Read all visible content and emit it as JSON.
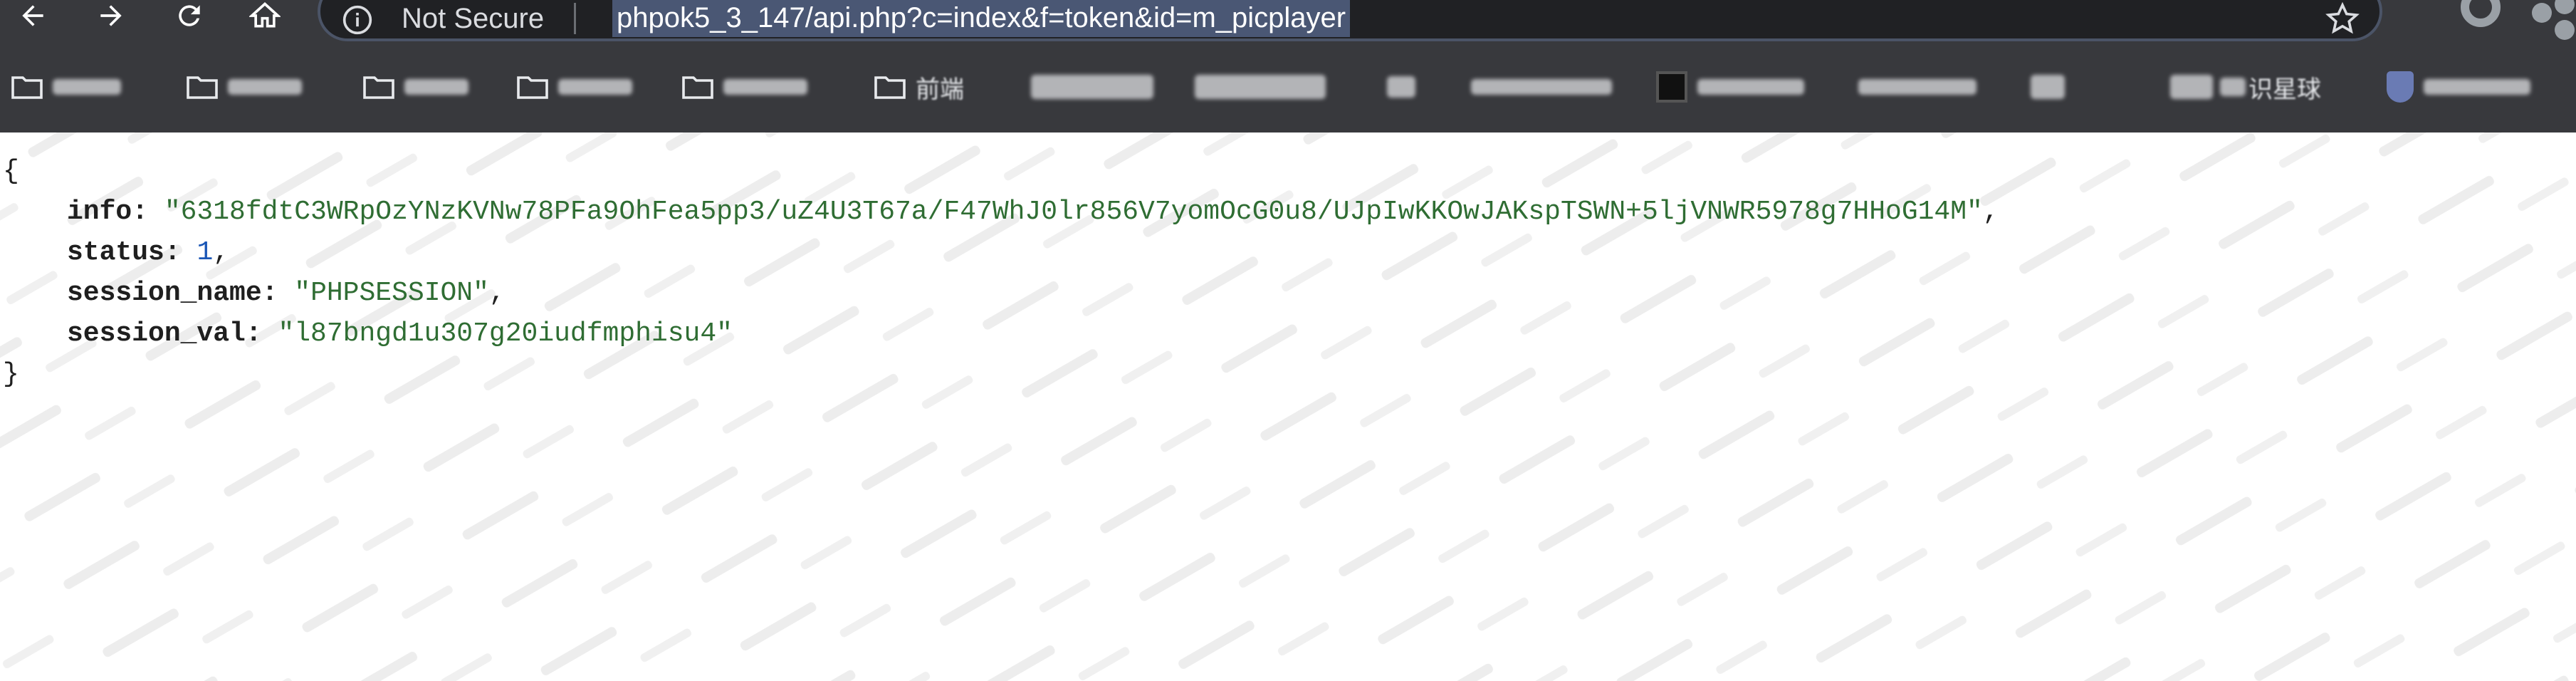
{
  "browser": {
    "security_label": "Not Secure",
    "url": "phpok5_3_147/api.php?c=index&f=token&id=m_picplayer",
    "icons": [
      "back-icon",
      "forward-icon",
      "reload-icon",
      "home-icon",
      "info-icon",
      "star-icon",
      "profile-icon",
      "extension-icon"
    ],
    "bookmarks": [
      {
        "label": ""
      },
      {
        "label": ""
      },
      {
        "label": ""
      },
      {
        "label": ""
      },
      {
        "label": ""
      },
      {
        "label": "前端"
      },
      {
        "label": ""
      },
      {
        "label": ""
      },
      {
        "label": ""
      },
      {
        "label": ""
      },
      {
        "label": ""
      },
      {
        "label": ""
      },
      {
        "label": ""
      },
      {
        "label": "识星球"
      },
      {
        "label": ""
      }
    ]
  },
  "response": {
    "open_brace": "{",
    "close_brace": "}",
    "info_key": "info",
    "info_value": "\"6318fdtC3WRpOzYNzKVNw78PFa9OhFea5pp3/uZ4U3T67a/F47WhJ0lr856V7yomOcG0u8/UJpIwKKOwJAKspTSWN+5ljVNWR5978g7HHoG14M\"",
    "status_key": "status",
    "status_value": "1",
    "session_name_key": "session_name",
    "session_name_value": "\"PHPSESSION\"",
    "session_val_key": "session_val",
    "session_val_value": "\"l87bngd1u307g20iudfmphisu4\""
  },
  "colors": {
    "chrome_bg": "#38393d",
    "string": "#2f6d33",
    "number": "#1a56b6",
    "url_highlight": "#4a5774"
  }
}
